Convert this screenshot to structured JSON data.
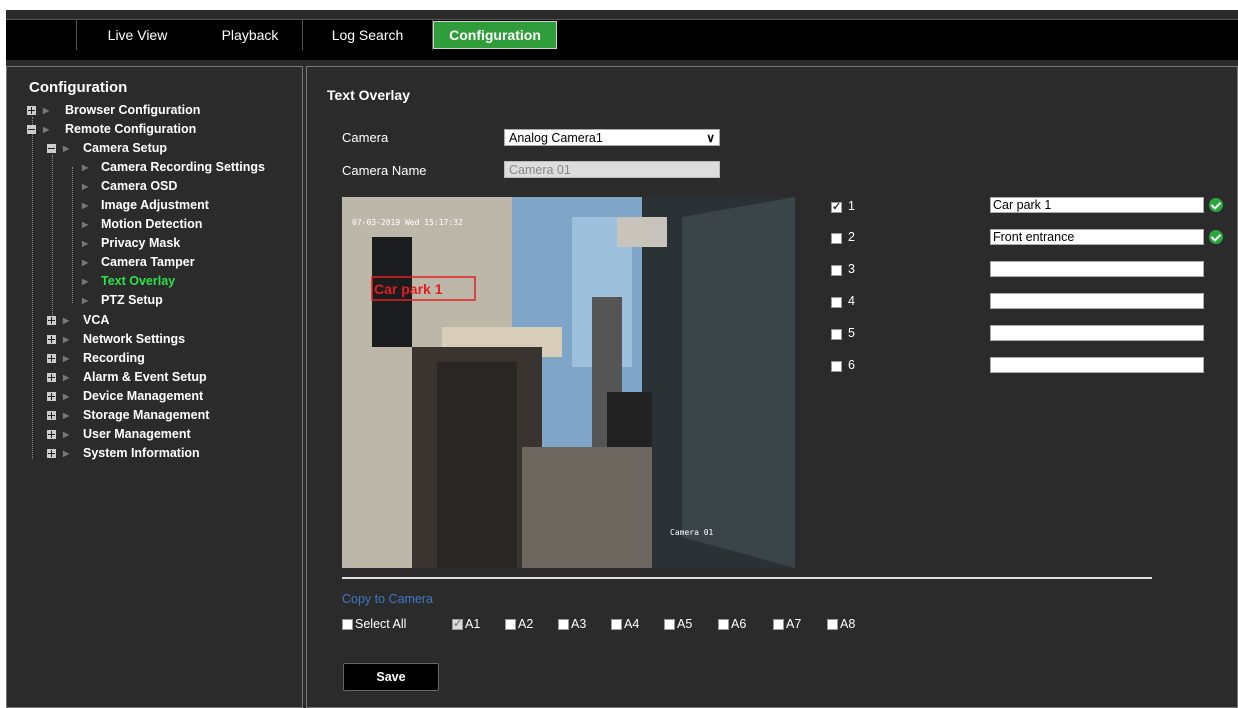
{
  "tabs": {
    "live_view": "Live View",
    "playback": "Playback",
    "log_search": "Log Search",
    "configuration": "Configuration"
  },
  "sidebar": {
    "title": "Configuration",
    "items": {
      "browser_configuration": "Browser Configuration",
      "remote_configuration": "Remote Configuration",
      "camera_setup": "Camera Setup",
      "camera_recording_settings": "Camera Recording Settings",
      "camera_osd": "Camera OSD",
      "image_adjustment": "Image Adjustment",
      "motion_detection": "Motion Detection",
      "privacy_mask": "Privacy Mask",
      "camera_tamper": "Camera Tamper",
      "text_overlay": "Text Overlay",
      "ptz_setup": "PTZ Setup",
      "vca": "VCA",
      "network_settings": "Network Settings",
      "recording": "Recording",
      "alarm_event_setup": "Alarm & Event Setup",
      "device_management": "Device Management",
      "storage_management": "Storage Management",
      "user_management": "User Management",
      "system_information": "System Information"
    }
  },
  "main": {
    "title": "Text Overlay",
    "camera_label": "Camera",
    "camera_value": "Analog Camera1",
    "camera_name_label": "Camera Name",
    "camera_name_value": "Camera 01",
    "preview": {
      "timestamp": "07-03-2019 Wed 15:17:32",
      "overlay_text": "Car park 1",
      "camera_caption": "Camera 01"
    },
    "overlays": [
      {
        "num": "1",
        "checked": true,
        "text": "Car park 1",
        "ok": true
      },
      {
        "num": "2",
        "checked": false,
        "text": "Front entrance",
        "ok": true
      },
      {
        "num": "3",
        "checked": false,
        "text": ""
      },
      {
        "num": "4",
        "checked": false,
        "text": ""
      },
      {
        "num": "5",
        "checked": false,
        "text": ""
      },
      {
        "num": "6",
        "checked": false,
        "text": ""
      }
    ],
    "copy": {
      "title": "Copy to Camera",
      "select_all": "Select All",
      "cameras": [
        {
          "label": "A1",
          "checked": true
        },
        {
          "label": "A2",
          "checked": false
        },
        {
          "label": "A3",
          "checked": false
        },
        {
          "label": "A4",
          "checked": false
        },
        {
          "label": "A5",
          "checked": false
        },
        {
          "label": "A6",
          "checked": false
        },
        {
          "label": "A7",
          "checked": false
        },
        {
          "label": "A8",
          "checked": false
        }
      ]
    },
    "save_label": "Save"
  },
  "colors": {
    "active_tab": "#2e9d3a",
    "active_tree_item": "#2ee04a",
    "copy_title": "#3c78c8",
    "ok_icon": "#27a83a",
    "overlay_box": "#e02020"
  }
}
